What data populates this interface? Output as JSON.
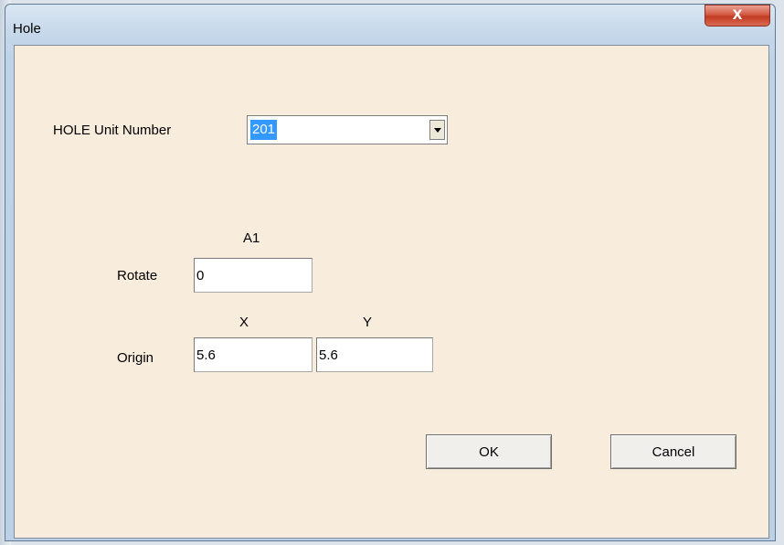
{
  "window": {
    "title": "Hole",
    "close_glyph": "X"
  },
  "unit": {
    "label": "HOLE  Unit Number",
    "value": "201"
  },
  "rotate": {
    "column_label": "A1",
    "label": "Rotate",
    "value": "0"
  },
  "origin": {
    "x_label": "X",
    "y_label": "Y",
    "label": "Origin",
    "x_value": "5.6",
    "y_value": "5.6"
  },
  "buttons": {
    "ok": "OK",
    "cancel": "Cancel"
  }
}
